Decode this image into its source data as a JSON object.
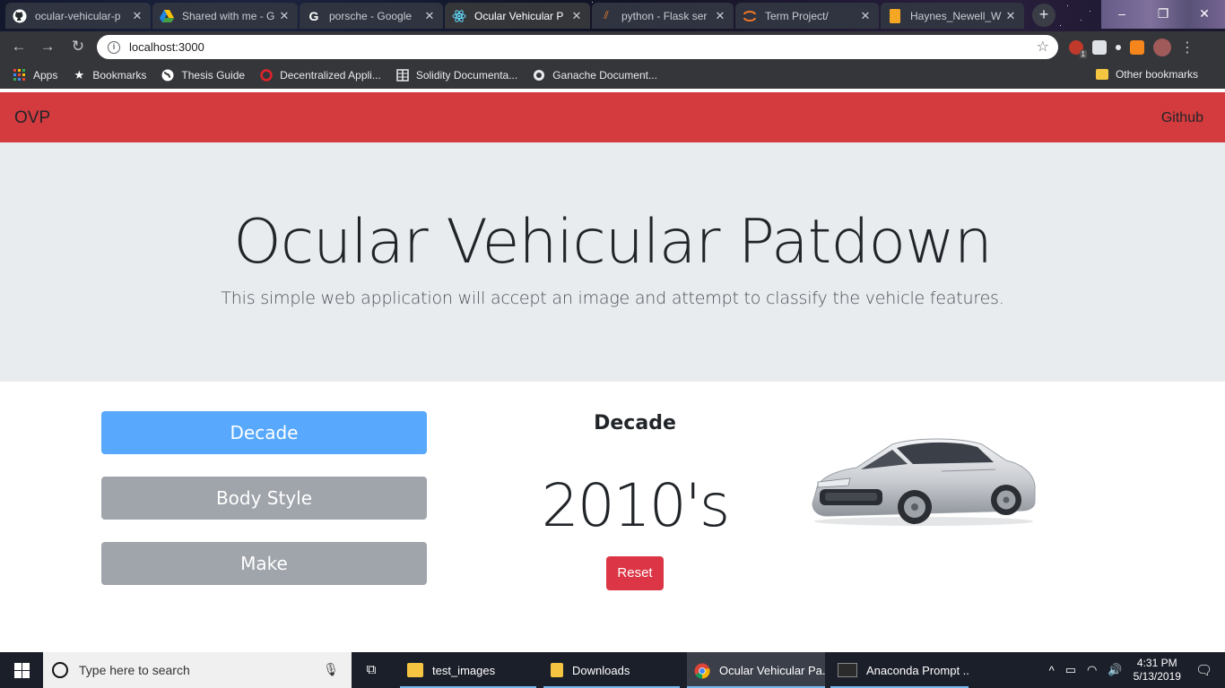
{
  "browser": {
    "tabs": [
      {
        "title": "ocular-vehicular-p",
        "icon": "github-icon"
      },
      {
        "title": "Shared with me - G",
        "icon": "google-drive-icon"
      },
      {
        "title": "porsche - Google",
        "icon": "google-icon"
      },
      {
        "title": "Ocular Vehicular P",
        "icon": "react-icon",
        "active": true
      },
      {
        "title": "python - Flask ser",
        "icon": "stackoverflow-icon"
      },
      {
        "title": "Term Project/",
        "icon": "jupyter-icon"
      },
      {
        "title": "Haynes_Newell_W",
        "icon": "document-icon"
      }
    ],
    "new_tab_label": "+",
    "url": "localhost:3000",
    "bookmarks": [
      {
        "label": "Apps",
        "icon": "apps-grid-icon"
      },
      {
        "label": "Bookmarks",
        "icon": "star-icon"
      },
      {
        "label": "Thesis Guide",
        "icon": "globe-icon"
      },
      {
        "label": "Decentralized Appli...",
        "icon": "opera-icon"
      },
      {
        "label": "Solidity Documenta...",
        "icon": "document-icon"
      },
      {
        "label": "Ganache Document...",
        "icon": "ganache-icon"
      }
    ],
    "other_bookmarks": "Other bookmarks",
    "extension_badge": "1"
  },
  "page": {
    "brand": "OVP",
    "nav_link": "Github",
    "hero_title": "Ocular Vehicular Patdown",
    "hero_subtitle": "This simple web application will accept an image and attempt to classify the vehicle features.",
    "feature_buttons": [
      {
        "label": "Decade",
        "active": true
      },
      {
        "label": "Body Style",
        "active": false
      },
      {
        "label": "Make",
        "active": false
      }
    ],
    "result_label": "Decade",
    "result_value": "2010's",
    "reset_label": "Reset",
    "colors": {
      "navbar": "#d33b3e",
      "active_button": "#58a9fd",
      "inactive_button": "#a0a4ab",
      "reset": "#dc3545",
      "jumbotron": "#e9ecef"
    }
  },
  "taskbar": {
    "search_placeholder": "Type here to search",
    "apps": [
      {
        "label": "test_images",
        "icon": "folder-icon"
      },
      {
        "label": "Downloads",
        "icon": "downloads-folder-icon"
      },
      {
        "label": "Ocular Vehicular Pa...",
        "icon": "chrome-icon",
        "active": true
      },
      {
        "label": "Anaconda Prompt ...",
        "icon": "terminal-icon"
      }
    ],
    "time": "4:31 PM",
    "date": "5/13/2019"
  }
}
